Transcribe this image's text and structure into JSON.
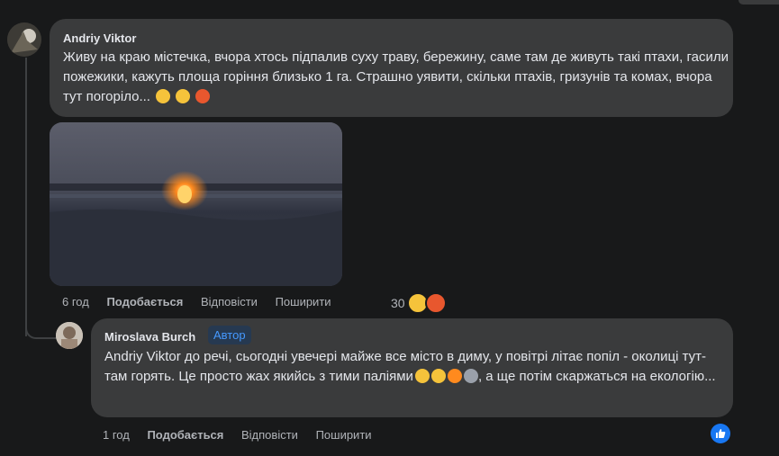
{
  "comment1": {
    "author": "Andriy Viktor",
    "text": "Живу на краю містечка, вчора хтось підпалив суху траву, бережину, саме там де живуть такі птахи, гасили пожежики, кажуть площа горіння близько 1 га. Страшно уявити, скільки птахів, гризунів та комах, вчора тут погоріло...",
    "emojis": [
      "sad-face-icon",
      "crying-face-icon",
      "angry-face-icon"
    ],
    "time": "6 год",
    "like": "Подобається",
    "reply": "Відповісти",
    "share": "Поширити",
    "reaction_count": "30",
    "reactions": [
      "care-reaction-icon",
      "angry-reaction-icon"
    ]
  },
  "comment2": {
    "author": "Miroslava Burch",
    "badge": "Автор",
    "text": "Andriy Viktor до речі, сьогодні увечері майже все місто в диму, у повітрі літає попіл - околиці тут-там горять. Це просто жах якийсь з тими паліями",
    "emojis": [
      "crying-cat-icon",
      "weary-cat-icon",
      "fire-icon",
      "cloud-icon"
    ],
    "text_end": ", а ще потім скаржаться на екологію...",
    "time": "1 год",
    "like": "Подобається",
    "reply": "Відповісти",
    "share": "Поширити",
    "reaction": "like-reaction-icon"
  },
  "colors": {
    "background": "#18191a",
    "bubble": "#3a3b3c",
    "author_badge_bg": "#263951",
    "author_badge_text": "#4599ff",
    "like_blue": "#1877f2",
    "fire": "#ff8a1e"
  }
}
